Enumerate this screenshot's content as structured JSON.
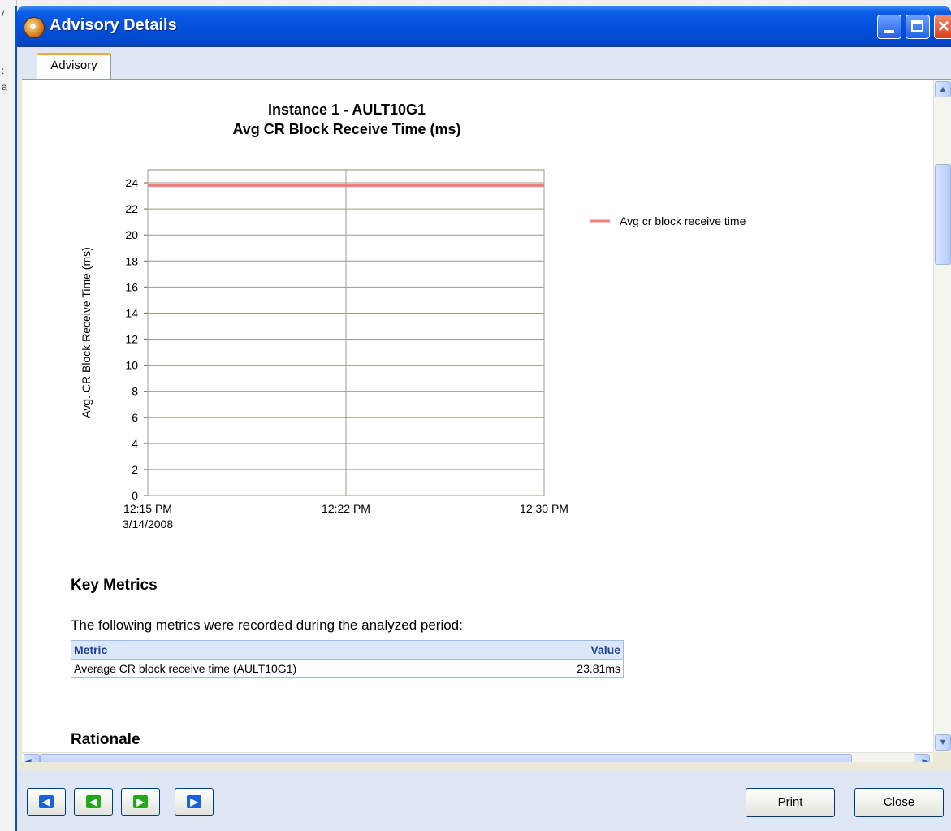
{
  "window": {
    "title": "Advisory Details"
  },
  "tabs": [
    {
      "label": "Advisory",
      "active": true
    }
  ],
  "chart_data": {
    "type": "line",
    "title": "Instance 1 - AULT10G1",
    "subtitle": "Avg CR Block Receive Time (ms)",
    "ylabel": "Avg. CR Block Receive Time (ms)",
    "xlabel": "",
    "ylim": [
      0,
      25
    ],
    "yticks": [
      0,
      2,
      4,
      6,
      8,
      10,
      12,
      14,
      16,
      18,
      20,
      22,
      24
    ],
    "xticks": [
      {
        "label": "12:15 PM",
        "sublabel": "3/14/2008"
      },
      {
        "label": "12:22 PM",
        "sublabel": ""
      },
      {
        "label": "12:30 PM",
        "sublabel": ""
      }
    ],
    "grid": true,
    "legend_position": "right",
    "series": [
      {
        "name": "Avg cr block receive time",
        "color": "#f08080",
        "x": [
          "12:15 PM",
          "12:22 PM",
          "12:30 PM"
        ],
        "values": [
          23.81,
          23.81,
          23.81
        ]
      }
    ]
  },
  "key_metrics": {
    "heading": "Key Metrics",
    "intro": "The following metrics were recorded during the analyzed period:",
    "columns": [
      "Metric",
      "Value"
    ],
    "rows": [
      [
        "Average CR block receive time (AULT10G1)",
        "23.81ms"
      ]
    ]
  },
  "rationale": {
    "heading": "Rationale"
  },
  "buttons": {
    "print": "Print",
    "close": "Close"
  },
  "nav_icons": [
    "first-record-icon",
    "previous-record-icon",
    "next-record-icon",
    "last-record-icon"
  ]
}
